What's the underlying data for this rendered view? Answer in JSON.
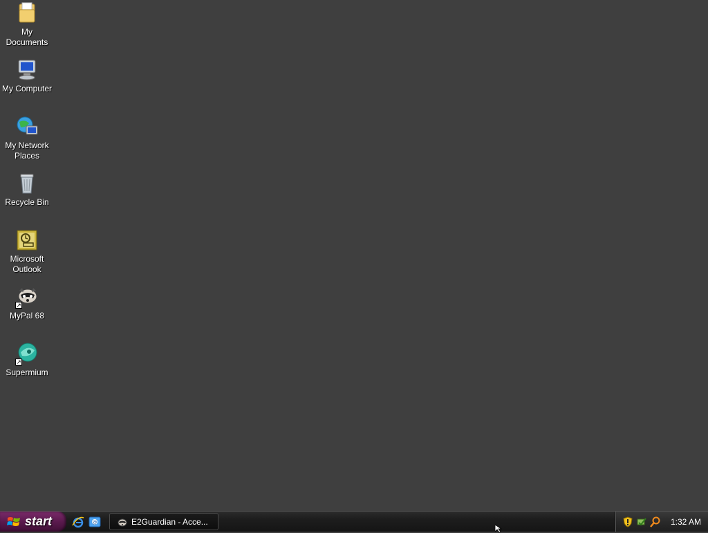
{
  "desktop": {
    "icons": [
      {
        "label": "My\nDocuments",
        "icon": "my-documents-folder-icon"
      },
      {
        "label": "My Computer",
        "icon": "my-computer-icon"
      },
      {
        "label": "My Network\nPlaces",
        "icon": "network-places-icon"
      },
      {
        "label": "Recycle Bin",
        "icon": "recycle-bin-icon"
      },
      {
        "label": "Microsoft\nOutlook",
        "icon": "outlook-icon"
      },
      {
        "label": "MyPal 68",
        "icon": "mypal-raccoon-icon"
      },
      {
        "label": "Supermium",
        "icon": "supermium-icon"
      }
    ],
    "background_color": "#3f3f3f"
  },
  "taskbar": {
    "start_label": "start",
    "quicklaunch": [
      {
        "icon": "internet-explorer-icon"
      },
      {
        "icon": "outlook-express-icon"
      }
    ],
    "tasks": [
      {
        "label": "E2Guardian - Acce...",
        "icon": "e2guardian-icon"
      }
    ],
    "tray": {
      "icons": [
        "security-shield-icon",
        "network-check-icon",
        "search-tray-icon"
      ],
      "clock": "1:32 AM"
    }
  }
}
